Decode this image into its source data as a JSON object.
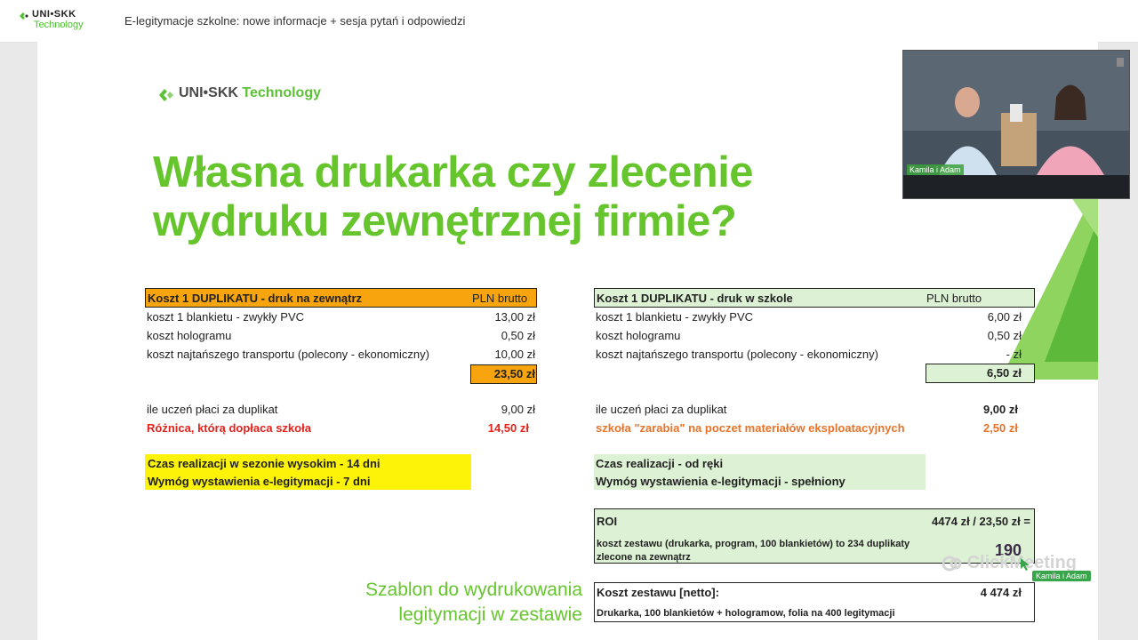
{
  "app": {
    "brand_top": "UNI•SKK",
    "brand_bottom": "Technology",
    "meeting_title": "E-legitymacje szkolne: nowe informacje + sesja pytań i odpowiedzi"
  },
  "slide": {
    "logo": {
      "part1": "UNI•SKK ",
      "part2": "Technology"
    },
    "heading": [
      "Własna drukarka czy zlecenie",
      "wydruku zewnętrznej firmie?"
    ],
    "left_table": {
      "header_label": "Koszt 1 DUPLIKATU - druk na zewnątrz",
      "header_unit": "PLN brutto",
      "rows": [
        {
          "label": "koszt 1 blankietu - zwykły PVC",
          "value": "13,00 zł"
        },
        {
          "label": "koszt hologramu",
          "value": "0,50 zł"
        },
        {
          "label": "koszt najtańszego transportu (polecony - ekonomiczny)",
          "value": "10,00 zł"
        }
      ],
      "sum": "23,50 zł",
      "pay_label": "ile uczeń płaci za duplikat",
      "pay_value": "9,00 zł",
      "diff_label": "Różnica, którą dopłaca szkoła",
      "diff_value": "14,50 zł",
      "time_line1": "Czas realizacji w sezonie wysokim - 14 dni",
      "time_line2": "Wymóg wystawienia e-legitymacji - 7 dni"
    },
    "right_table": {
      "header_label": "Koszt 1 DUPLIKATU - druk w szkole",
      "header_unit": "PLN brutto",
      "rows": [
        {
          "label": "koszt 1 blankietu - zwykły PVC",
          "value": "6,00 zł"
        },
        {
          "label": "koszt hologramu",
          "value": "0,50 zł"
        },
        {
          "label": "koszt najtańszego transportu (polecony - ekonomiczny)",
          "value": "-  zł"
        }
      ],
      "sum": "6,50 zł",
      "pay_label": "ile uczeń płaci za duplikat",
      "pay_value": "9,00 zł",
      "gain_label": "szkoła \"zarabia\" na poczet materiałów eksploatacyjnych",
      "gain_value": "2,50 zł",
      "time_line1": "Czas realizacji - od ręki",
      "time_line2": "Wymóg wystawienia e-legitymacji - spełniony"
    },
    "roi": {
      "label": "ROI",
      "formula": "4474 zł / 23,50 zł =",
      "desc1": "koszt zestawu (drukarka, program, 100 blankietów) to 234 duplikaty",
      "desc2": "zlecone na zewnątrz",
      "value": "190"
    },
    "kit": {
      "label": "Koszt zestawu [netto]:",
      "value": "4 474 zł",
      "desc": "Drukarka, 100 blankietów + hologramow, folia na 400 legitymacji"
    },
    "template_caption": [
      "Szablon do wydrukowania",
      "legitymacji w zestawie"
    ]
  },
  "webcam": {
    "label": "Kamila i Adam"
  },
  "cursor_label": "Kamila i Adam",
  "watermark": "ClickMeeting",
  "colors": {
    "brand_green": "#66c52d",
    "orange": "#f7a40e",
    "light_green": "#ddf1d5",
    "yellow": "#fdf309",
    "red": "#e3221b"
  }
}
